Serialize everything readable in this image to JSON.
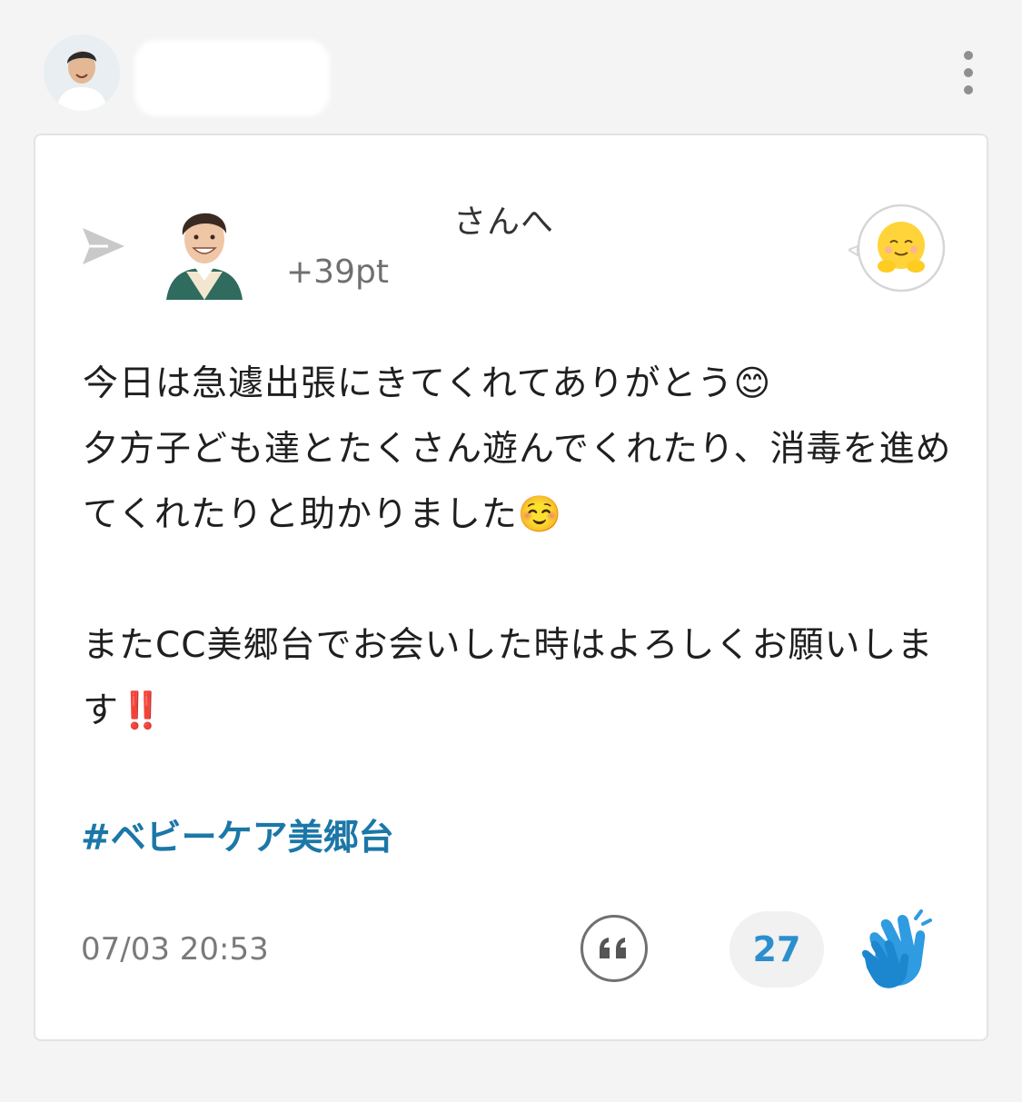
{
  "post": {
    "recipient_suffix": "さんへ",
    "points": "+39pt",
    "message": "今日は急遽出張にきてくれてありがとう😊\n夕方子ども達とたくさん遊んでくれたり、消毒を進めてくれたりと助かりました☺️\n\nまたCC美郷台でお会いした時はよろしくお願いします‼️",
    "hashtag": "#ベビーケア美郷台",
    "timestamp": "07/03 20:53",
    "clap_count": "27"
  },
  "icons": {
    "more": "more-vertical-icon",
    "send": "send-arrow-icon",
    "stamp": "hug-face-stamp-icon",
    "quote": "quote-icon",
    "clap": "clapping-hands-icon"
  },
  "colors": {
    "hashtag": "#1b77a8",
    "clap_count": "#2b8fce",
    "clap_icon": "#2f9be0"
  }
}
